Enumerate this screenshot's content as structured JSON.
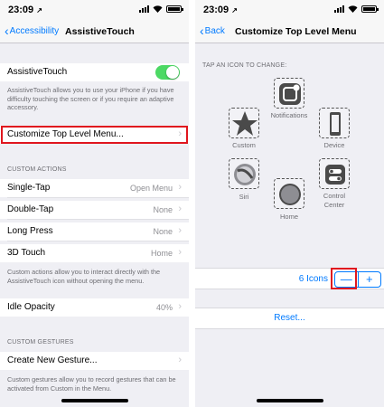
{
  "status": {
    "time": "23:09",
    "location_arrow": "↗"
  },
  "left": {
    "back_label": "Accessibility",
    "title": "AssistiveTouch",
    "assistive_label": "AssistiveTouch",
    "assistive_on": true,
    "assistive_footer": "AssistiveTouch allows you to use your iPhone if you have difficulty touching the screen or if you require an adaptive accessory.",
    "customize_label": "Customize Top Level Menu...",
    "custom_actions_header": "CUSTOM ACTIONS",
    "actions": [
      {
        "label": "Single-Tap",
        "value": "Open Menu"
      },
      {
        "label": "Double-Tap",
        "value": "None"
      },
      {
        "label": "Long Press",
        "value": "None"
      },
      {
        "label": "3D Touch",
        "value": "Home"
      }
    ],
    "actions_footer": "Custom actions allow you to interact directly with the AssistiveTouch icon without opening the menu.",
    "idle_label": "Idle Opacity",
    "idle_value": "40%",
    "gestures_header": "CUSTOM GESTURES",
    "gesture_label": "Create New Gesture...",
    "gestures_footer": "Custom gestures allow you to record gestures that can be activated from Custom in the Menu."
  },
  "right": {
    "back_label": "Back",
    "title": "Customize Top Level Menu",
    "tap_header": "TAP AN ICON TO CHANGE:",
    "icons": {
      "notifications": "Notifications",
      "custom": "Custom",
      "device": "Device",
      "siri": "Siri",
      "home": "Home",
      "control_center_1": "Control",
      "control_center_2": "Center"
    },
    "icon_count": "6 Icons",
    "minus": "—",
    "plus": "+",
    "reset": "Reset...",
    "accent": "#007aff",
    "highlight": "#e0161e"
  }
}
